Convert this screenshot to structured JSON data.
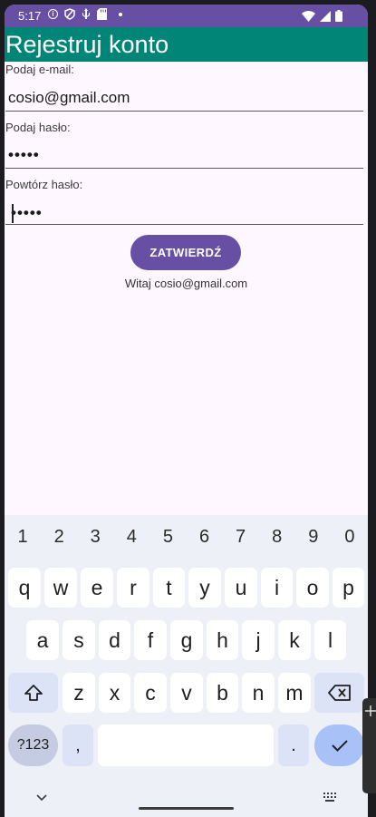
{
  "status": {
    "time": "5:17"
  },
  "appbar": {
    "title": "Rejestruj konto"
  },
  "form": {
    "email_label": "Podaj e-mail:",
    "email_value": "cosio@gmail.com",
    "password_label": "Podaj hasło:",
    "password_value": "•••••",
    "repeat_label": "Powtórz hasło:",
    "repeat_value": "•••••",
    "submit_label": "ZATWIERDŹ",
    "greeting": "Witaj cosio@gmail.com"
  },
  "keyboard": {
    "numbers": [
      "1",
      "2",
      "3",
      "4",
      "5",
      "6",
      "7",
      "8",
      "9",
      "0"
    ],
    "row1": [
      "q",
      "w",
      "e",
      "r",
      "t",
      "y",
      "u",
      "i",
      "o",
      "p"
    ],
    "row2": [
      "a",
      "s",
      "d",
      "f",
      "g",
      "h",
      "j",
      "k",
      "l"
    ],
    "row3": [
      "z",
      "x",
      "c",
      "v",
      "b",
      "n",
      "m"
    ],
    "symbols_label": "?123",
    "comma": ",",
    "period": "."
  },
  "colors": {
    "primary": "#6750a4",
    "appbar": "#008577",
    "background": "#fef7ff"
  }
}
